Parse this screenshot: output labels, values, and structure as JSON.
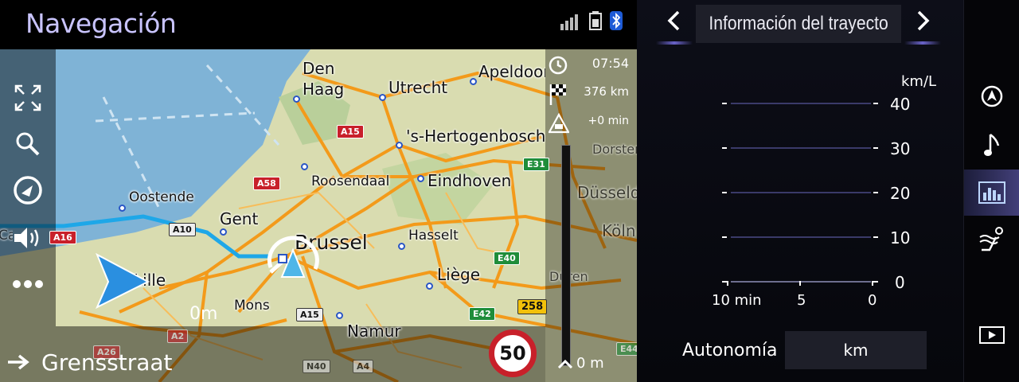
{
  "nav": {
    "title": "Navegación",
    "clock": "07:54",
    "remaining_distance": "376 km",
    "delay": "+0 min",
    "street": "Grensstraat",
    "next_turn_distance": "0m",
    "speed_limit": "50",
    "bar_distance": "0 m",
    "cities": {
      "den_haag_1": "Den",
      "den_haag_2": "Haag",
      "utrecht": "Utrecht",
      "apeldoorn": "Apeldoorn",
      "hertogenbosch": "'s-Hertogenbosch",
      "roosendaal": "Roosendaal",
      "eindhoven": "Eindhoven",
      "oostende": "Oostende",
      "gent": "Gent",
      "brussel": "Brussel",
      "hasselt": "Hasselt",
      "liege": "Liège",
      "mons": "Mons",
      "namur": "Namur",
      "lille": "Lille",
      "dusseldorf": "Düsseldorf",
      "koln": "Köln",
      "duren": "Düren",
      "dorsten": "Dorsten",
      "calais": "Calais"
    },
    "roads": {
      "a15_top": "A15",
      "a58": "A58",
      "a10": "A10",
      "a16": "A16",
      "e31": "E31",
      "e40": "E40",
      "e42": "E42",
      "r258": "258",
      "a15_bottom": "A15",
      "a2": "A2",
      "a26": "A26",
      "n40": "N40",
      "a4": "A4",
      "e44": "E44"
    },
    "side_buttons": [
      "expand-icon",
      "search-icon",
      "route-icon",
      "volume-icon",
      "more-icon"
    ]
  },
  "trip": {
    "title": "Información del trayecto",
    "unit": "km/L",
    "y_ticks": [
      "40",
      "30",
      "20",
      "10",
      "0"
    ],
    "x_ticks": [
      "10 min",
      "5",
      "0"
    ],
    "autonomia_label": "Autonomía",
    "autonomia_value": "km"
  },
  "chart_data": {
    "type": "bar",
    "title": "",
    "xlabel": "",
    "ylabel": "km/L",
    "categories": [
      "10 min",
      "5",
      "0"
    ],
    "values": [],
    "ylim": [
      0,
      40
    ],
    "y_ticks": [
      0,
      10,
      20,
      30,
      40
    ],
    "grid": true
  },
  "mode_bar": [
    "navigation-icon",
    "music-icon",
    "trip-info-icon",
    "climate-seat-icon",
    "media-icon"
  ],
  "colors": {
    "accent": "#6a63c9",
    "title_purple": "#c9c4ff",
    "route": "#1ea7e8",
    "road": "#f39a1a",
    "speed_red": "#c8202a"
  }
}
